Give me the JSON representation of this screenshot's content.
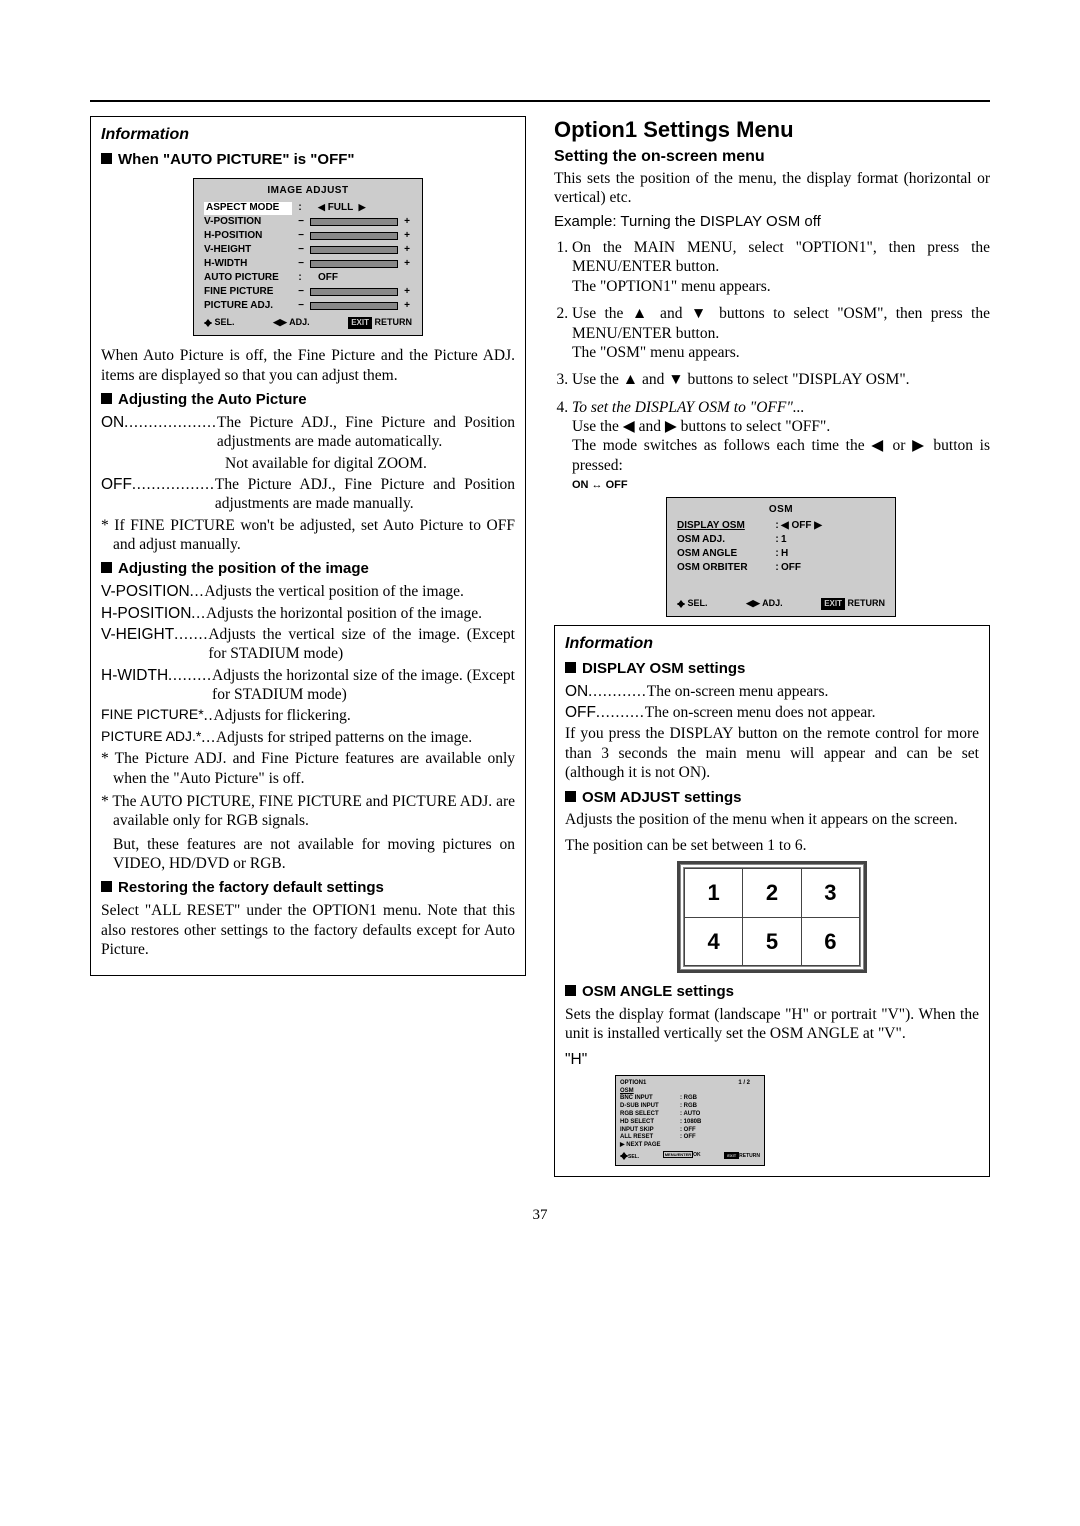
{
  "left": {
    "info_heading": "Information",
    "sec1": "When \"AUTO PICTURE\" is \"OFF\"",
    "osd_title": "IMAGE ADJUST",
    "osd_items": [
      {
        "label": "ASPECT MODE",
        "type": "val",
        "val": "FULL",
        "hi": true
      },
      {
        "label": "V-POSITION",
        "type": "bar"
      },
      {
        "label": "H-POSITION",
        "type": "bar"
      },
      {
        "label": "V-HEIGHT",
        "type": "bar"
      },
      {
        "label": "H-WIDTH",
        "type": "bar"
      },
      {
        "label": "AUTO PICTURE",
        "type": "val",
        "val": "OFF"
      },
      {
        "label": "FINE PICTURE",
        "type": "bar"
      },
      {
        "label": "PICTURE ADJ.",
        "type": "bar"
      }
    ],
    "osd_sel": "SEL.",
    "osd_adj": "ADJ.",
    "osd_exit": "EXIT",
    "osd_return": "RETURN",
    "p1": "When Auto Picture is off, the Fine Picture and the Picture ADJ. items are displayed so that you can adjust them.",
    "sec2": "Adjusting the Auto Picture",
    "on_t": "ON",
    "on_dots": "...................",
    "on_d": "The Picture ADJ., Fine Picture and Position adjustments are made automatically.",
    "on_d2": "Not available for digital ZOOM.",
    "off_t": "OFF",
    "off_dots": ".................",
    "off_d": "The Picture ADJ., Fine Picture and Position adjustments are made manually.",
    "n1": "* If FINE PICTURE won't be adjusted, set Auto Picture to OFF and adjust manually.",
    "sec3": "Adjusting the position of the image",
    "vpos_t": "V-POSITION",
    "vpos_dots": " ...",
    "vpos_d": "Adjusts the vertical position of the image.",
    "hpos_t": "H-POSITION",
    "hpos_dots": " ...",
    "hpos_d": "Adjusts the horizontal position of the image.",
    "vh_t": "V-HEIGHT",
    "vh_dots": " .......",
    "vh_d": "Adjusts the vertical size of the image. (Except for STADIUM mode)",
    "hw_t": "H-WIDTH",
    "hw_dots": " .........",
    "hw_d": "Adjusts the horizontal size of the image. (Except for STADIUM mode)",
    "fp_t": "FINE PICTURE*",
    "fp_dots": " ..",
    "fp_d": "Adjusts for flickering.",
    "pa_t": "PICTURE ADJ.*",
    "pa_dots": " ...",
    "pa_d": "Adjusts for striped patterns on the image.",
    "n2": "* The Picture ADJ. and Fine Picture features are available only when the \"Auto Picture\" is off.",
    "n3": "* The AUTO PICTURE, FINE PICTURE and PICTURE ADJ. are available only for RGB signals.",
    "n3b": "But, these features are not available for moving pictures on VIDEO, HD/DVD or RGB.",
    "sec4": "Restoring the factory default settings",
    "p4": "Select \"ALL RESET\" under the OPTION1 menu. Note that this also restores other settings to the factory defaults except for Auto Picture."
  },
  "right": {
    "h1": "Option1 Settings Menu",
    "h2": "Setting the on-screen menu",
    "intro": "This sets the position of the menu, the display format (horizontal or vertical) etc.",
    "ex": "Example: Turning the DISPLAY OSM off",
    "li1a": "On the MAIN MENU, select \"OPTION1\", then press the MENU/ENTER button.",
    "li1b": "The \"OPTION1\" menu appears.",
    "li2a": "Use the ▲ and ▼ buttons to select \"OSM\", then press the MENU/ENTER button.",
    "li2b": "The \"OSM\" menu appears.",
    "li3": "Use the ▲ and ▼ buttons to select \"DISPLAY OSM\".",
    "li4i": "To set the DISPLAY OSM to \"OFF\"...",
    "li4a": "Use the ◀ and ▶ buttons to select \"OFF\".",
    "li4b": "The mode switches as follows each time the ◀ or ▶ button is pressed:",
    "onoff": "ON ↔ OFF",
    "osd2_title": "OSM",
    "osd2": [
      {
        "label": "DISPLAY OSM",
        "v": "◀ OFF ▶",
        "hi": true
      },
      {
        "label": "OSM ADJ.",
        "v": "1"
      },
      {
        "label": "OSM ANGLE",
        "v": "H"
      },
      {
        "label": "OSM ORBITER",
        "v": "OFF"
      }
    ],
    "osd2_sel": "SEL.",
    "osd2_adj": "ADJ.",
    "osd2_exit": "EXIT",
    "osd2_return": "RETURN",
    "info_heading": "Information",
    "sec_d": "DISPLAY OSM settings",
    "d_on_t": "ON",
    "d_on_dots": "............",
    "d_on_d": "The on-screen menu appears.",
    "d_off_t": "OFF",
    "d_off_dots": "..........",
    "d_off_d": "The on-screen menu does not appear.",
    "d_p": "If you press the DISPLAY button on the remote control for more than 3 seconds the main menu will appear and can be set (although it is not ON).",
    "sec_a": "OSM ADJUST settings",
    "a_p1": "Adjusts the position of the menu when it appears on the screen.",
    "a_p2": "The position can be set between 1 to 6.",
    "grid": [
      "1",
      "2",
      "3",
      "4",
      "5",
      "6"
    ],
    "sec_ang": "OSM ANGLE settings",
    "ang_p": "Sets the display format (landscape \"H\" or portrait \"V\"). When the unit is installed vertically set the OSM ANGLE at \"V\".",
    "ang_h": "\"H\"",
    "tiny_title": "OPTION1",
    "tiny_page": "1 / 2",
    "tiny": [
      {
        "l": "OSM",
        "v": "",
        "hi": true
      },
      {
        "l": "BNC INPUT",
        "v": "RGB"
      },
      {
        "l": "D-SUB INPUT",
        "v": "RGB"
      },
      {
        "l": "RGB SELECT",
        "v": "AUTO"
      },
      {
        "l": "HD SELECT",
        "v": "1080B"
      },
      {
        "l": "INPUT SKIP",
        "v": "OFF"
      },
      {
        "l": "ALL RESET",
        "v": "OFF"
      },
      {
        "l": "▶  NEXT PAGE",
        "v": ""
      }
    ],
    "tiny_sel": "SEL.",
    "tiny_ok": "OK",
    "tiny_exit": "EXIT",
    "tiny_return": "RETURN"
  },
  "pagenum": "37"
}
